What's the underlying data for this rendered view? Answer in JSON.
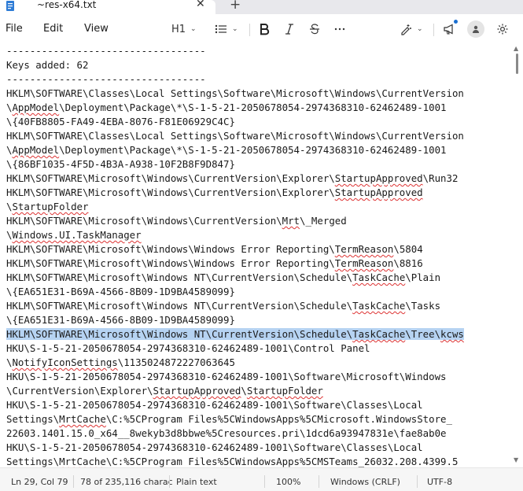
{
  "tab": {
    "title": "~res-x64.txt",
    "close_glyph": "✕",
    "new_glyph": "+"
  },
  "menu": {
    "file": "File",
    "edit": "Edit",
    "view": "View"
  },
  "toolbar": {
    "heading": "H1"
  },
  "editor": {
    "lines": [
      "----------------------------------",
      "Keys added: 62",
      "----------------------------------",
      "HKLM\\SOFTWARE\\Classes\\Local Settings\\Software\\Microsoft\\Windows\\CurrentVersion",
      "\\AppModel\\Deployment\\Package\\*\\S-1-5-21-2050678054-2974368310-62462489-1001",
      "\\{40FB8805-FA49-4EBA-8076-F81E06929C4C}",
      "HKLM\\SOFTWARE\\Classes\\Local Settings\\Software\\Microsoft\\Windows\\CurrentVersion",
      "\\AppModel\\Deployment\\Package\\*\\S-1-5-21-2050678054-2974368310-62462489-1001",
      "\\{86BF1035-4F5D-4B3A-A938-10F2B8F9D847}",
      "HKLM\\SOFTWARE\\Microsoft\\Windows\\CurrentVersion\\Explorer\\StartupApproved\\Run32",
      "HKLM\\SOFTWARE\\Microsoft\\Windows\\CurrentVersion\\Explorer\\StartupApproved",
      "\\StartupFolder",
      "HKLM\\SOFTWARE\\Microsoft\\Windows\\CurrentVersion\\Mrt\\_Merged",
      "\\Windows.UI.TaskManager",
      "HKLM\\SOFTWARE\\Microsoft\\Windows\\Windows Error Reporting\\TermReason\\5804",
      "HKLM\\SOFTWARE\\Microsoft\\Windows\\Windows Error Reporting\\TermReason\\8816",
      "HKLM\\SOFTWARE\\Microsoft\\Windows NT\\CurrentVersion\\Schedule\\TaskCache\\Plain",
      "\\{EA651E31-B69A-4566-8B09-1D9BA4589099}",
      "HKLM\\SOFTWARE\\Microsoft\\Windows NT\\CurrentVersion\\Schedule\\TaskCache\\Tasks",
      "\\{EA651E31-B69A-4566-8B09-1D9BA4589099}",
      "HKLM\\SOFTWARE\\Microsoft\\Windows NT\\CurrentVersion\\Schedule\\TaskCache\\Tree\\kcws",
      "HKU\\S-1-5-21-2050678054-2974368310-62462489-1001\\Control Panel",
      "\\NotifyIconSettings\\1135024872227063645",
      "HKU\\S-1-5-21-2050678054-2974368310-62462489-1001\\Software\\Microsoft\\Windows",
      "\\CurrentVersion\\Explorer\\StartupApproved\\StartupFolder",
      "HKU\\S-1-5-21-2050678054-2974368310-62462489-1001\\Software\\Classes\\Local",
      "Settings\\MrtCache\\C:%5CProgram Files%5CWindowsApps%5CMicrosoft.WindowsStore_",
      "22603.1401.15.0_x64__8wekyb3d8bbwe%5Cresources.pri\\1dcd6a93947831e\\fae8ab0e",
      "HKU\\S-1-5-21-2050678054-2974368310-62462489-1001\\Software\\Classes\\Local",
      "Settings\\MrtCache\\C:%5CProgram Files%5CWindowsApps%5CMSTeams_26032.208.4399.5"
    ],
    "selected_line": 20,
    "misspelled": [
      "AppModel",
      "StartupApproved",
      "StartupFolder",
      "Mrt",
      "Windows.UI.TaskManager",
      "TermReason",
      "TaskCache",
      "kcws",
      "NotifyIconSettings",
      "MrtCache"
    ]
  },
  "status": {
    "position": "Ln 29, Col 79",
    "chars": "78 of 235,116 charac",
    "format": "Plain text",
    "zoom": "100%",
    "line_ending": "Windows (CRLF)",
    "encoding": "UTF-8"
  },
  "colors": {
    "selection": "#b6d3f2",
    "tab_strip": "#e8e8ec",
    "status_bar": "#f6f6f6",
    "accent": "#1a6fd1"
  }
}
